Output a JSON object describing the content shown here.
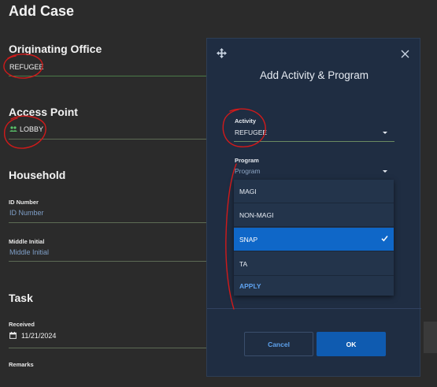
{
  "page": {
    "title": "Add Case",
    "originating_office": {
      "heading": "Originating Office",
      "value": "REFUGEE"
    },
    "access_point": {
      "heading": "Access Point",
      "value": "LOBBY"
    },
    "household": {
      "heading": "Household",
      "id_number": {
        "label": "ID Number",
        "placeholder": "ID Number"
      },
      "middle_initial": {
        "label": "Middle Initial",
        "placeholder": "Middle Initial"
      }
    },
    "task": {
      "heading": "Task",
      "received": {
        "label": "Received",
        "value": "11/21/2024"
      },
      "remarks": {
        "label": "Remarks"
      }
    }
  },
  "modal": {
    "title": "Add Activity & Program",
    "activity": {
      "label": "Activity",
      "value": "REFUGEE"
    },
    "program": {
      "label": "Program",
      "placeholder": "Program"
    },
    "dropdown": {
      "options": [
        "MAGI",
        "NON-MAGI",
        "SNAP",
        "TA"
      ],
      "selected": "SNAP",
      "apply_label": "APPLY"
    },
    "buttons": {
      "cancel": "Cancel",
      "ok": "OK"
    }
  },
  "icons": {
    "move": "move-arrows-icon",
    "close": "close-icon",
    "access_point": "people-icon",
    "received": "calendar-icon",
    "selected_option": "checkmark-icon",
    "dropdown": "caret-down-icon"
  },
  "colors": {
    "background": "#2b2b2b",
    "modal": "#1f2d42",
    "accent": "#0f67c8",
    "link": "#5ea2ee",
    "annotation": "#d11a1a"
  }
}
